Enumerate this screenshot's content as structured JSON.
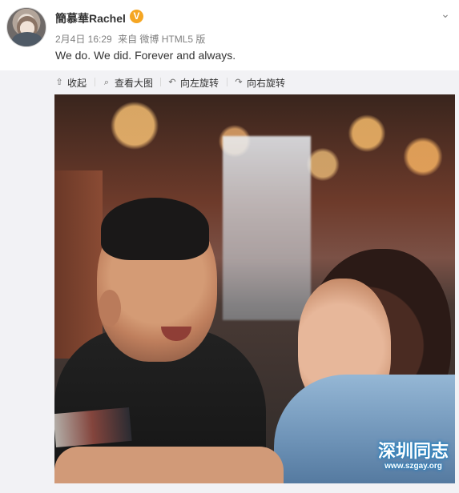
{
  "header": {
    "username": "簡慕華Rachel",
    "verified_mark": "V",
    "date": "2月4日 16:29",
    "source": "来自 微博 HTML5 版",
    "post_text": "We do. We did. Forever and always.",
    "menu_icon": "chevron-down-icon"
  },
  "toolbar": {
    "collapse": "收起",
    "view_large": "查看大图",
    "rotate_left": "向左旋转",
    "rotate_right": "向右旋转"
  },
  "icons": {
    "collapse": "up-arrow-icon",
    "view_large": "search-icon",
    "rotate_left": "rotate-left-icon",
    "rotate_right": "rotate-right-icon"
  },
  "watermark": {
    "title": "深圳同志",
    "url": "www.szgay.org"
  },
  "colors": {
    "verified": "#f5a623",
    "meta": "#808080",
    "toolbar_bg": "#f2f2f5"
  }
}
